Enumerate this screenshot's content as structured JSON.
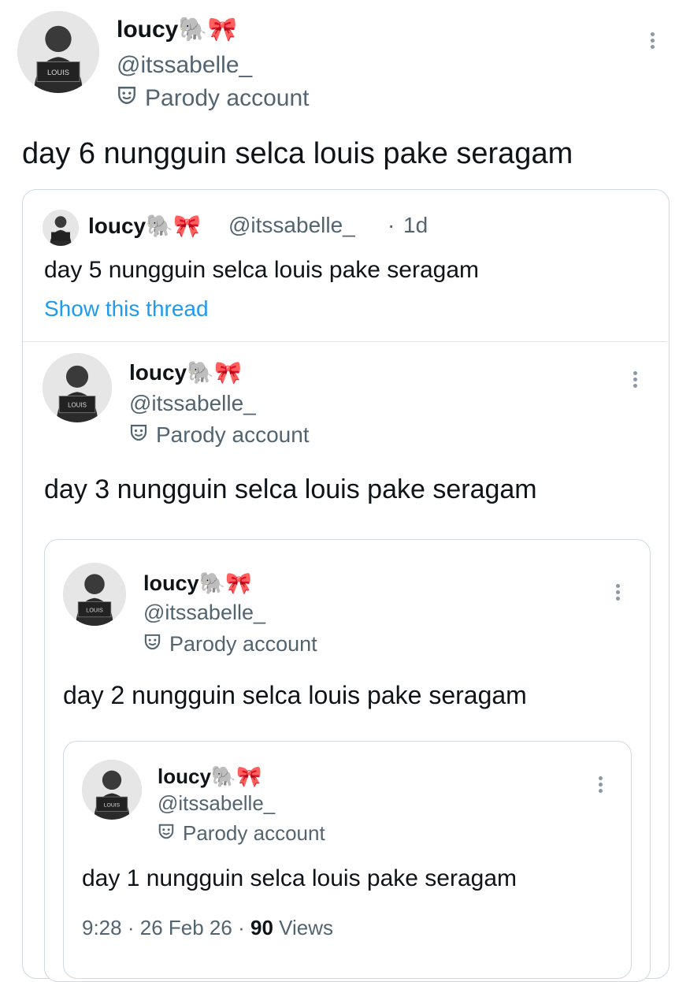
{
  "main": {
    "name": "loucy🐘🎀",
    "handle": "@itssabelle_",
    "parody_label": "Parody account",
    "text": "day 6 nungguin selca louis pake seragam"
  },
  "quote1": {
    "name": "loucy🐘🎀",
    "handle": "@itssabelle_",
    "separator": "·",
    "time": "1d",
    "text": "day 5 nungguin selca louis pake seragam",
    "show_thread": "Show this thread"
  },
  "quote2": {
    "name": "loucy🐘🎀",
    "handle": "@itssabelle_",
    "parody_label": "Parody account",
    "text": "day 3 nungguin selca louis pake seragam"
  },
  "quote3": {
    "name": "loucy🐘🎀",
    "handle": "@itssabelle_",
    "parody_label": "Parody account",
    "text": "day 2 nungguin selca louis pake seragam"
  },
  "quote4": {
    "name": "loucy🐘🎀",
    "handle": "@itssabelle_",
    "parody_label": "Parody account",
    "text": "day 1 nungguin selca louis pake seragam",
    "meta_time": "9:28",
    "meta_date": "26 Feb 26",
    "meta_views_count": "90",
    "meta_views_label": "Views",
    "meta_sep": "·"
  },
  "icons": {
    "parody": "theater-mask-icon",
    "more": "more-options-icon",
    "avatar": "profile-photo"
  }
}
